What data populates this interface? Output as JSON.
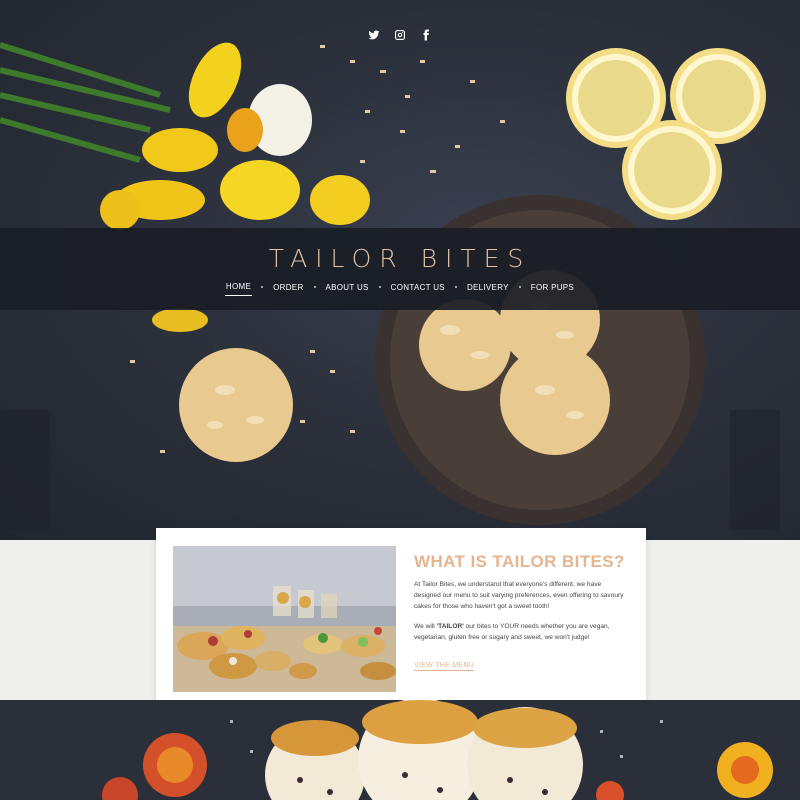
{
  "social": {
    "twitter_icon": "twitter-icon",
    "instagram_icon": "instagram-icon",
    "facebook_icon": "facebook-icon"
  },
  "header": {
    "brand": "TAILOR BITES"
  },
  "nav": {
    "items": [
      "HOME",
      "ORDER",
      "ABOUT US",
      "CONTACT US",
      "DELIVERY",
      "FOR PUPS"
    ],
    "active": "HOME"
  },
  "about": {
    "title": "WHAT IS TAILOR BITES?",
    "para1": "At Tailor Bites, we understand that everyone's different, we have designed our menu to suit varying preferences, even offering to savoury cakes for those who haven't got a sweet tooth!",
    "para2_a": "We will ",
    "para2_b": "'TAILOR'",
    "para2_c": " our bites to YOUR needs whether you are vegan, vegetarian, gluten free or sugary and sweet, we won't judge!",
    "link": "VIEW THE MENU"
  },
  "colors": {
    "accent": "#e6b48f",
    "brand_text": "#e0c2a7",
    "dark_bg": "#2b2f39",
    "light_bg": "#efefed"
  }
}
